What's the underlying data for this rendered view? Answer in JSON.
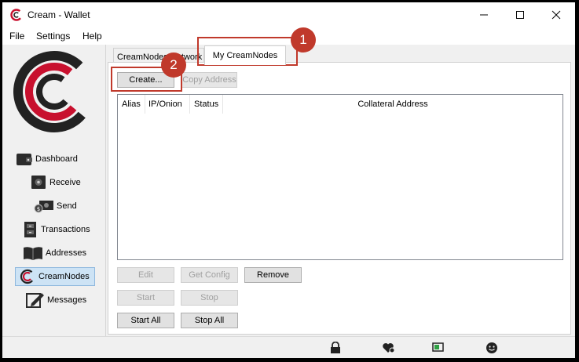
{
  "window": {
    "title": "Cream - Wallet"
  },
  "menu": {
    "file": "File",
    "settings": "Settings",
    "help": "Help"
  },
  "sidebar": {
    "items": [
      {
        "label": "Dashboard"
      },
      {
        "label": "Receive"
      },
      {
        "label": "Send"
      },
      {
        "label": "Transactions"
      },
      {
        "label": "Addresses"
      },
      {
        "label": "CreamNodes"
      },
      {
        "label": "Messages"
      }
    ],
    "active": "CreamNodes"
  },
  "tabs": [
    {
      "label": "CreamNodes Network"
    },
    {
      "label": "My CreamNodes"
    }
  ],
  "toolbar": {
    "create": "Create...",
    "copy_address": "Copy Address"
  },
  "table": {
    "headers": [
      "Alias",
      "IP/Onion",
      "Status",
      "Collateral Address"
    ],
    "rows": []
  },
  "buttons": {
    "edit": "Edit",
    "get_config": "Get Config",
    "remove": "Remove",
    "start": "Start",
    "stop": "Stop",
    "start_all": "Start All",
    "stop_all": "Stop All"
  },
  "annotations": {
    "one": "1",
    "two": "2"
  },
  "colors": {
    "brand": "#c8102e",
    "annotation": "#c0392b",
    "active_nav": "#cde3f5"
  }
}
